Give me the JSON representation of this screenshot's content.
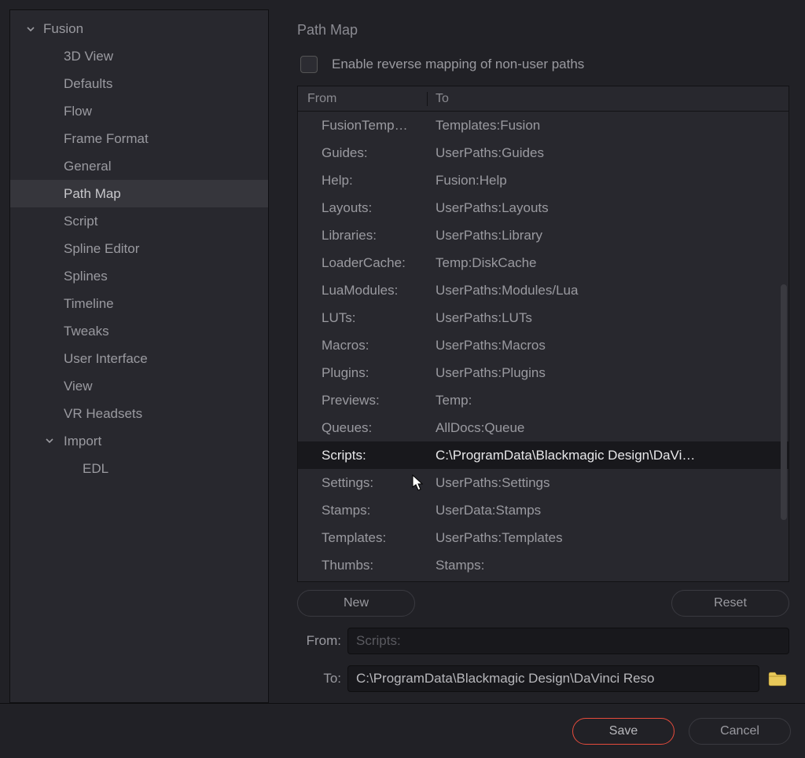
{
  "sidebar": {
    "root": {
      "label": "Fusion"
    },
    "items": [
      {
        "label": "3D View"
      },
      {
        "label": "Defaults"
      },
      {
        "label": "Flow"
      },
      {
        "label": "Frame Format"
      },
      {
        "label": "General"
      },
      {
        "label": "Path Map"
      },
      {
        "label": "Script"
      },
      {
        "label": "Spline Editor"
      },
      {
        "label": "Splines"
      },
      {
        "label": "Timeline"
      },
      {
        "label": "Tweaks"
      },
      {
        "label": "User Interface"
      },
      {
        "label": "View"
      },
      {
        "label": "VR Headsets"
      }
    ],
    "import": {
      "label": "Import"
    },
    "import_items": [
      {
        "label": "EDL"
      }
    ]
  },
  "page": {
    "title": "Path Map",
    "checkbox_label": "Enable reverse mapping of non-user paths",
    "header_from": "From",
    "header_to": "To",
    "rows": [
      {
        "from": "FusionTemp…",
        "to": "Templates:Fusion"
      },
      {
        "from": "Guides:",
        "to": "UserPaths:Guides"
      },
      {
        "from": "Help:",
        "to": "Fusion:Help"
      },
      {
        "from": "Layouts:",
        "to": "UserPaths:Layouts"
      },
      {
        "from": "Libraries:",
        "to": "UserPaths:Library"
      },
      {
        "from": "LoaderCache:",
        "to": "Temp:DiskCache"
      },
      {
        "from": "LuaModules:",
        "to": "UserPaths:Modules/Lua"
      },
      {
        "from": "LUTs:",
        "to": "UserPaths:LUTs"
      },
      {
        "from": "Macros:",
        "to": "UserPaths:Macros"
      },
      {
        "from": "Plugins:",
        "to": "UserPaths:Plugins"
      },
      {
        "from": "Previews:",
        "to": "Temp:"
      },
      {
        "from": "Queues:",
        "to": "AllDocs:Queue"
      },
      {
        "from": "Scripts:",
        "to": "C:\\ProgramData\\Blackmagic Design\\DaVi…"
      },
      {
        "from": "Settings:",
        "to": "UserPaths:Settings"
      },
      {
        "from": "Stamps:",
        "to": "UserData:Stamps"
      },
      {
        "from": "Templates:",
        "to": "UserPaths:Templates"
      },
      {
        "from": "Thumbs:",
        "to": "Stamps:"
      }
    ],
    "selected_row": 12,
    "new_label": "New",
    "reset_label": "Reset",
    "from_label": "From:",
    "to_label": "To:",
    "from_value": "Scripts:",
    "to_value": "C:\\ProgramData\\Blackmagic Design\\DaVinci Reso"
  },
  "footer": {
    "save_label": "Save",
    "cancel_label": "Cancel"
  }
}
